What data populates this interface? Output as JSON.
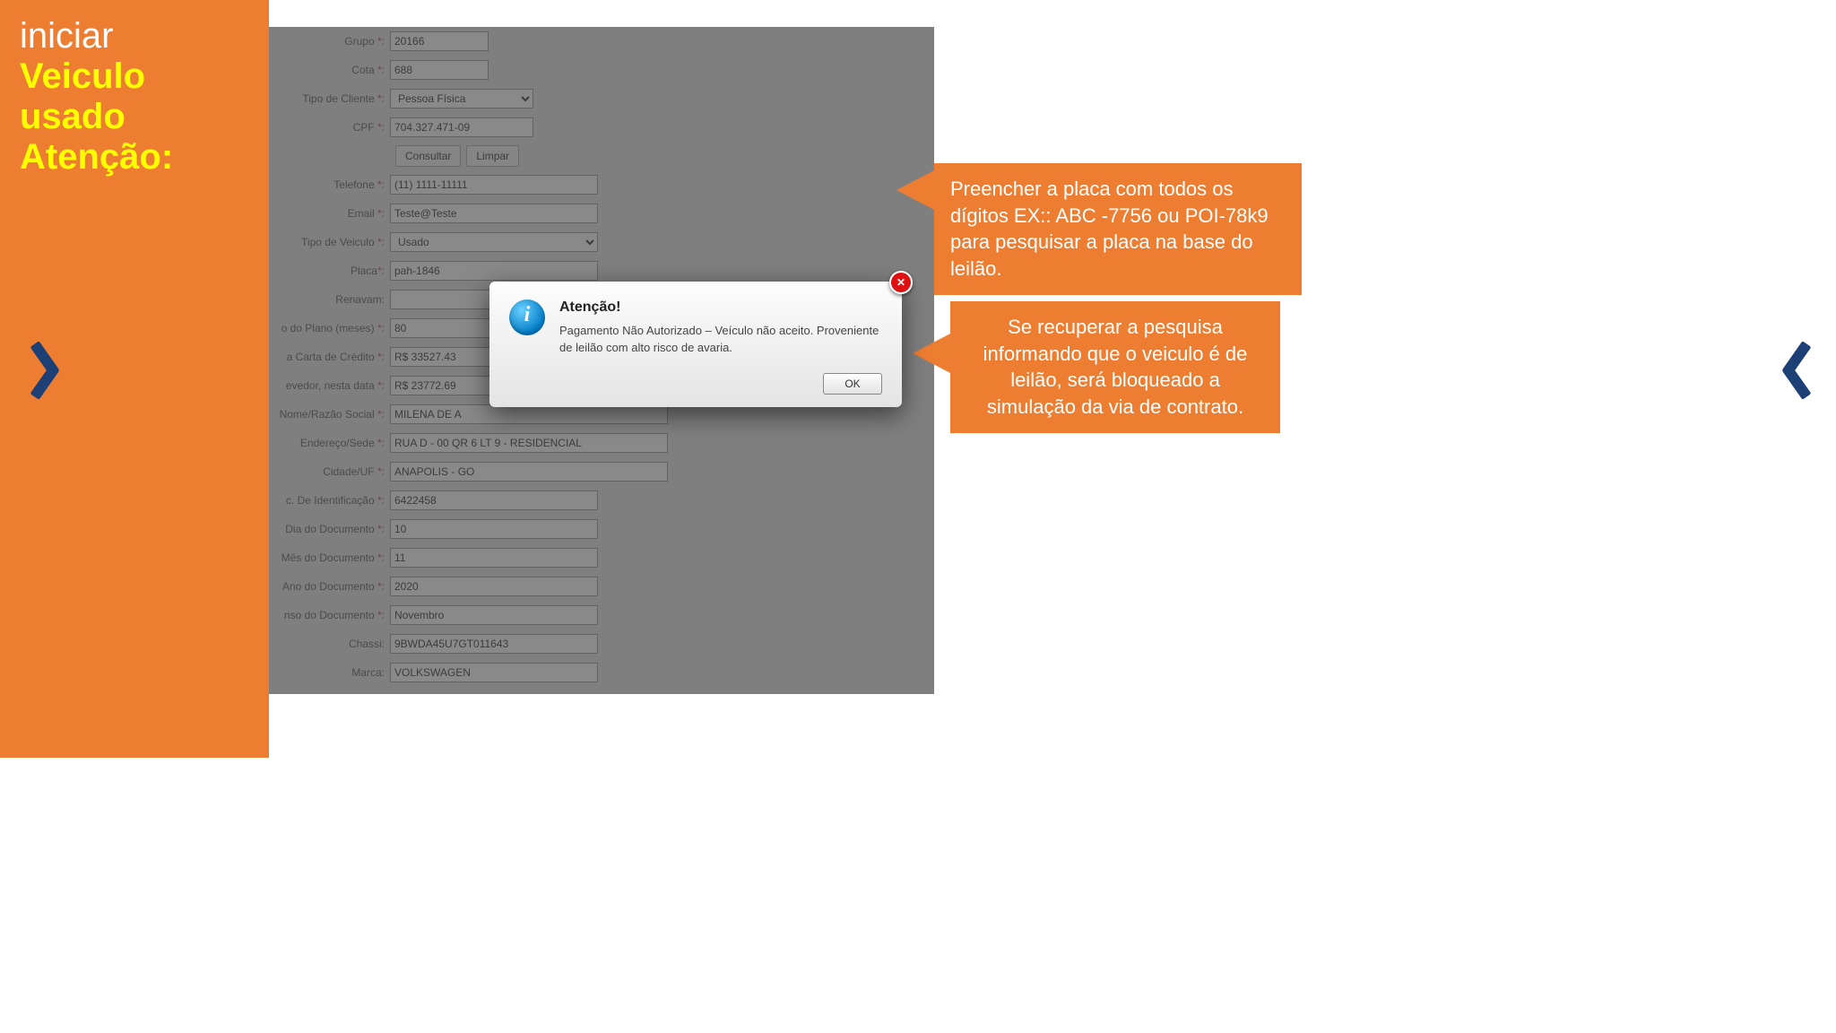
{
  "sidebar": {
    "line1": "iniciar",
    "line2": "Veiculo usado",
    "line3": "Atenção:"
  },
  "callouts": {
    "c1": "Preencher a placa com todos os dígitos EX:: ABC -7756 ou POI-78k9  para pesquisar a placa na base do leilão.",
    "c2": "Se recuperar a pesquisa informando que o veiculo é de leilão, será bloqueado a simulação da via de contrato."
  },
  "dialog": {
    "title": "Atenção!",
    "message": "Pagamento Não Autorizado – Veículo não aceito. Proveniente de leilão com alto risco de avaria.",
    "ok": "OK"
  },
  "form": {
    "grupo": {
      "label": "Grupo",
      "value": "20166"
    },
    "cota": {
      "label": "Cota",
      "value": "688"
    },
    "tipo_cliente": {
      "label": "Tipo de Cliente",
      "value": "Pessoa Física"
    },
    "cpf": {
      "label": "CPF",
      "value": "704.327.471-09"
    },
    "consultar": "Consultar",
    "limpar": "Limpar",
    "telefone": {
      "label": "Telefone",
      "value": "(11) 1111-11111"
    },
    "email": {
      "label": "Email",
      "value": "Teste@Teste"
    },
    "tipo_veiculo": {
      "label": "Tipo de Veiculo",
      "value": "Usado"
    },
    "placa": {
      "label": "Placa",
      "value": "pah-1846"
    },
    "renavam": {
      "label": "Renavam:",
      "value": ""
    },
    "plano": {
      "label": "o do Plano (meses)",
      "value": "80"
    },
    "carta": {
      "label": "a Carta de Crédito",
      "value": "R$ 33527.43"
    },
    "devedor": {
      "label": "evedor, nesta data",
      "value": "R$ 23772.69"
    },
    "nome": {
      "label": "Nome/Razão Social",
      "value": "MILENA DE A"
    },
    "endereco": {
      "label": "Endereço/Sede",
      "value": "RUA D - 00 QR 6 LT 9 - RESIDENCIAL"
    },
    "cidade": {
      "label": "Cidade/UF",
      "value": "ANAPOLIS - GO"
    },
    "ident": {
      "label": "c. De Identificação",
      "value": "6422458"
    },
    "dia": {
      "label": "Dia do Documento",
      "value": "10"
    },
    "mes": {
      "label": "Mês do Documento",
      "value": "11"
    },
    "ano": {
      "label": "Ano do Documento",
      "value": "2020"
    },
    "extenso": {
      "label": "nso do Documento",
      "value": "Novembro"
    },
    "chassi": {
      "label": "Chassi:",
      "value": "9BWDA45U7GT011643"
    },
    "marca": {
      "label": "Marca:",
      "value": "VOLKSWAGEN"
    }
  }
}
